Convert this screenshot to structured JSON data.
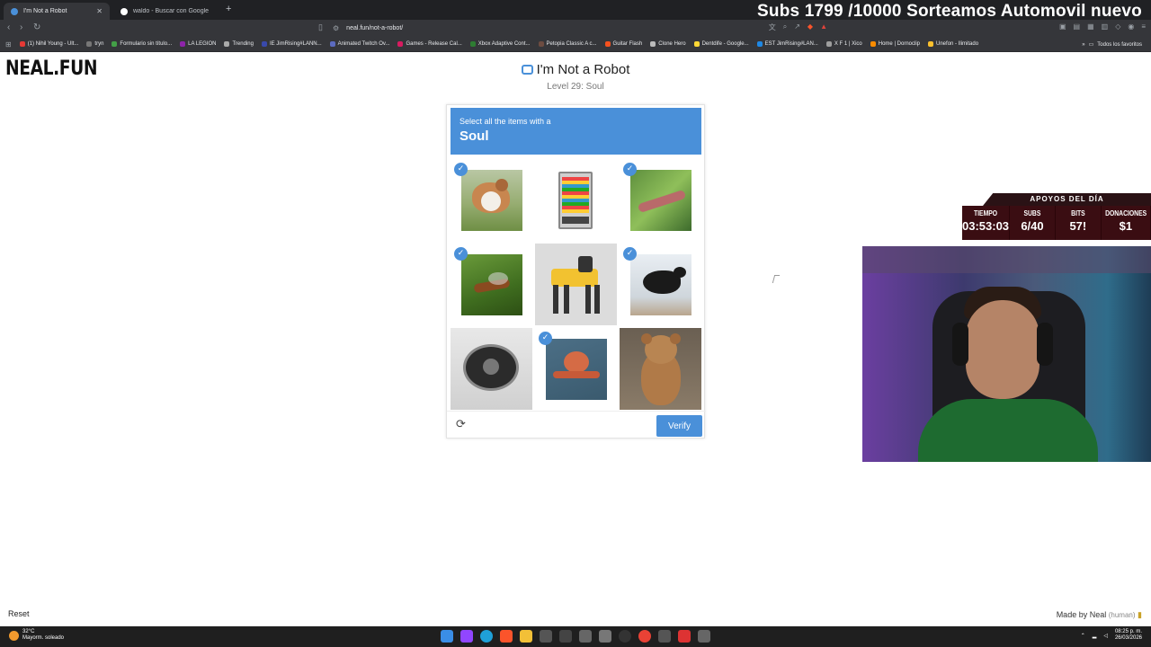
{
  "browser": {
    "tabs": [
      {
        "title": "I'm Not a Robot",
        "active": true
      },
      {
        "title": "waldo - Buscar con Google",
        "active": false
      }
    ],
    "url": "neal.fun/not-a-robot/",
    "bookmarks": [
      "(1) Nihil Young - Ult...",
      "tryn",
      "Formulario sin título...",
      "LA LEGION",
      "Trending",
      "IE JimRising#LANN...",
      "Animated Twitch Ov...",
      "Games - Release Cal...",
      "Xbox Adaptive Cont...",
      "Petopia Classic A c...",
      "Guitar Flash",
      "Clone Hero",
      "Dentdife - Google...",
      "EST JimRising#LAN...",
      "X F 1 | Xico",
      "Home | Dornoclip",
      "Unefon - Ilimitado"
    ],
    "all_bookmarks": "Todos los favoritos"
  },
  "stream": {
    "banner": "Subs 1799 /10000 Sorteamos Automovil nuevo",
    "stats_title": "APOYOS DEL DÍA",
    "stats": [
      {
        "label": "TIEMPO",
        "value": "03:53:03"
      },
      {
        "label": "SUBS",
        "value": "6/40"
      },
      {
        "label": "BITS",
        "value": "57!"
      },
      {
        "label": "DONACIONES",
        "value": "$1"
      }
    ]
  },
  "page": {
    "logo": "NEAL.FUN",
    "title": "I'm Not a Robot",
    "level": "Level 29: Soul",
    "captcha": {
      "instruction": "Select all the items with a",
      "keyword": "Soul",
      "verify_label": "Verify",
      "tiles": [
        {
          "name": "dog",
          "selected": true
        },
        {
          "name": "vending machine",
          "selected": false
        },
        {
          "name": "worm",
          "selected": true
        },
        {
          "name": "mosquito",
          "selected": true
        },
        {
          "name": "robot dog",
          "selected": false
        },
        {
          "name": "crow",
          "selected": true
        },
        {
          "name": "robot vacuum",
          "selected": false
        },
        {
          "name": "octopus",
          "selected": true
        },
        {
          "name": "teddy bear",
          "selected": false
        }
      ]
    },
    "reset_label": "Reset",
    "made_by": "Made by Neal",
    "made_by_note": "(human)"
  },
  "taskbar": {
    "temperature": "32°C",
    "weather": "Mayorm. soleado",
    "time": "08:25 p. m.",
    "date": "26/03/2026"
  },
  "colors": {
    "accent": "#4a90d9",
    "chrome_dark": "#35363a",
    "stats_bg": "#3a0d12"
  }
}
